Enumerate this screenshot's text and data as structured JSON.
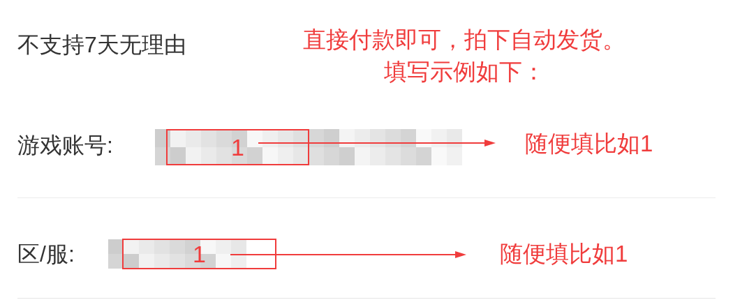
{
  "policy_note": "不支持7天无理由",
  "annotation": {
    "lines": [
      "直接付款即可，拍下自动发货。",
      "填写示例如下："
    ]
  },
  "fields": [
    {
      "label": "游戏账号:",
      "value": "1",
      "hint": "随便填比如1"
    },
    {
      "label": "区/服:",
      "value": "1",
      "hint": "随便填比如1"
    }
  ]
}
